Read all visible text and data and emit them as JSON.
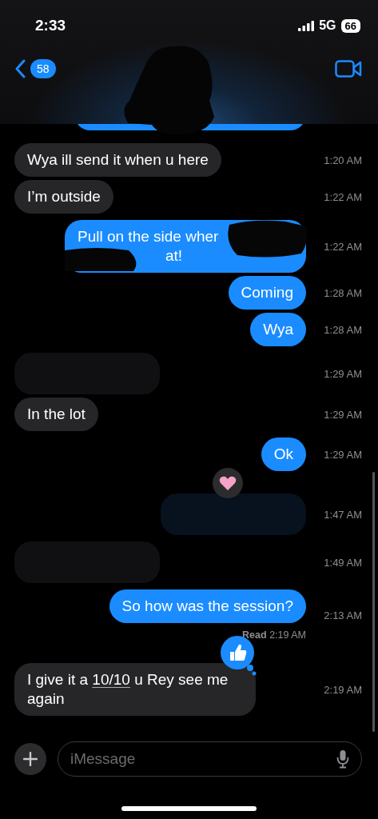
{
  "status_bar": {
    "time": "2:33",
    "network": "5G",
    "battery": "66"
  },
  "header": {
    "unread_count": "58"
  },
  "messages": [
    {
      "kind": "cut",
      "outgoing": true
    },
    {
      "kind": "text",
      "outgoing": false,
      "lines": [
        "Wya ill send it when u here"
      ],
      "time": "1:20 AM"
    },
    {
      "kind": "text",
      "outgoing": false,
      "lines": [
        "I’m outside"
      ],
      "time": "1:22 AM"
    },
    {
      "kind": "partial",
      "outgoing": true,
      "lines": [
        "Pull on the side wher",
        "at!"
      ],
      "time": "1:22 AM"
    },
    {
      "kind": "text",
      "outgoing": true,
      "lines": [
        "Coming"
      ],
      "time": "1:28 AM"
    },
    {
      "kind": "text",
      "outgoing": true,
      "lines": [
        "Wya"
      ],
      "time": "1:28 AM"
    },
    {
      "kind": "redacted",
      "outgoing": false,
      "time": "1:29 AM"
    },
    {
      "kind": "text",
      "outgoing": false,
      "lines": [
        "In the lot"
      ],
      "time": "1:29 AM"
    },
    {
      "kind": "text",
      "outgoing": true,
      "lines": [
        "Ok"
      ],
      "time": "1:29 AM"
    },
    {
      "kind": "redacted",
      "outgoing": true,
      "time": "1:47 AM",
      "reaction": {
        "kind": "heart"
      }
    },
    {
      "kind": "redacted",
      "outgoing": false,
      "time": "1:49 AM"
    },
    {
      "kind": "text",
      "outgoing": true,
      "lines": [
        "So how was the session?"
      ],
      "time": "2:13 AM",
      "receipt": "**Read** 2:19 AM"
    },
    {
      "kind": "parts",
      "outgoing": false,
      "parts": [
        {
          "text": "I give it a "
        },
        {
          "text": "10/10",
          "kind": "link"
        },
        {
          "text": " u Rey see me again"
        }
      ],
      "time": "2:19 AM",
      "reaction": {
        "kind": "thumbs_up"
      }
    }
  ],
  "composer": {
    "placeholder": "iMessage"
  }
}
